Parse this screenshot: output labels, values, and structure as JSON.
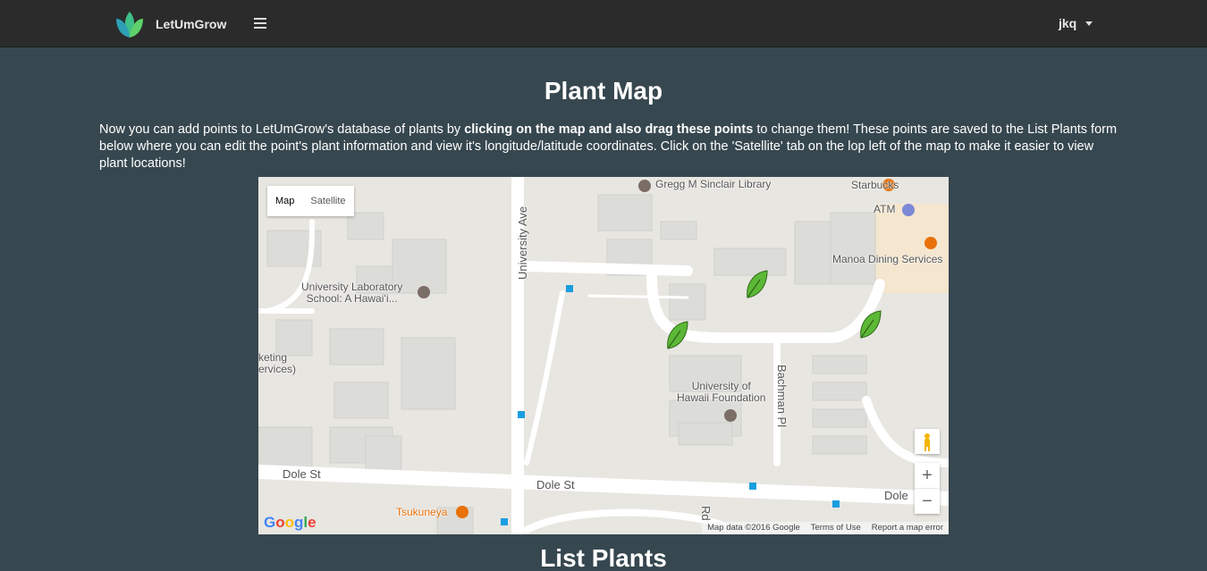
{
  "navbar": {
    "brand": "LetUmGrow",
    "user": "jkq"
  },
  "page": {
    "title": "Plant Map",
    "intro_part1": "Now you can add points to LetUmGrow's database of plants by ",
    "intro_bold": "clicking on the map and also drag these points",
    "intro_part2": " to change them! These points are saved to the List Plants form below where you can edit the point's plant information and view it's longitude/latitude coordinates. Click on the 'Satellite' tab on the lop left of the map to make it easier to view plant locations!",
    "list_title": "List Plants"
  },
  "map": {
    "type_controls": [
      "Map",
      "Satellite"
    ],
    "selected_type": "Map",
    "zoom_in": "+",
    "zoom_out": "−",
    "google": "Google",
    "attribution": [
      "Map data ©2016 Google",
      "Terms of Use",
      "Report a map error"
    ],
    "labels": {
      "library": "Gregg M Sinclair Library",
      "starbucks": "Starbucks",
      "atm": "ATM",
      "dining": "Manoa Dining Services",
      "lab_school_1": "University Laboratory",
      "lab_school_2": "School: A Hawaiʻi...",
      "marketing_1": "keting",
      "marketing_2": "ervices)",
      "foundation_1": "University of",
      "foundation_2": "Hawaii Foundation",
      "tsukuneya": "Tsukuneya"
    },
    "streets": {
      "university_ave": "University Ave",
      "bachman": "Bachman Pl",
      "dole_west": "Dole St",
      "dole_mid": "Dole St",
      "dole_east": "Dole",
      "rd": "Rd"
    },
    "markers": [
      "plant-marker",
      "plant-marker",
      "plant-marker"
    ],
    "colors": {
      "marker": "#5cb837",
      "road": "#ffffff",
      "building": "#dcdcd8"
    }
  }
}
